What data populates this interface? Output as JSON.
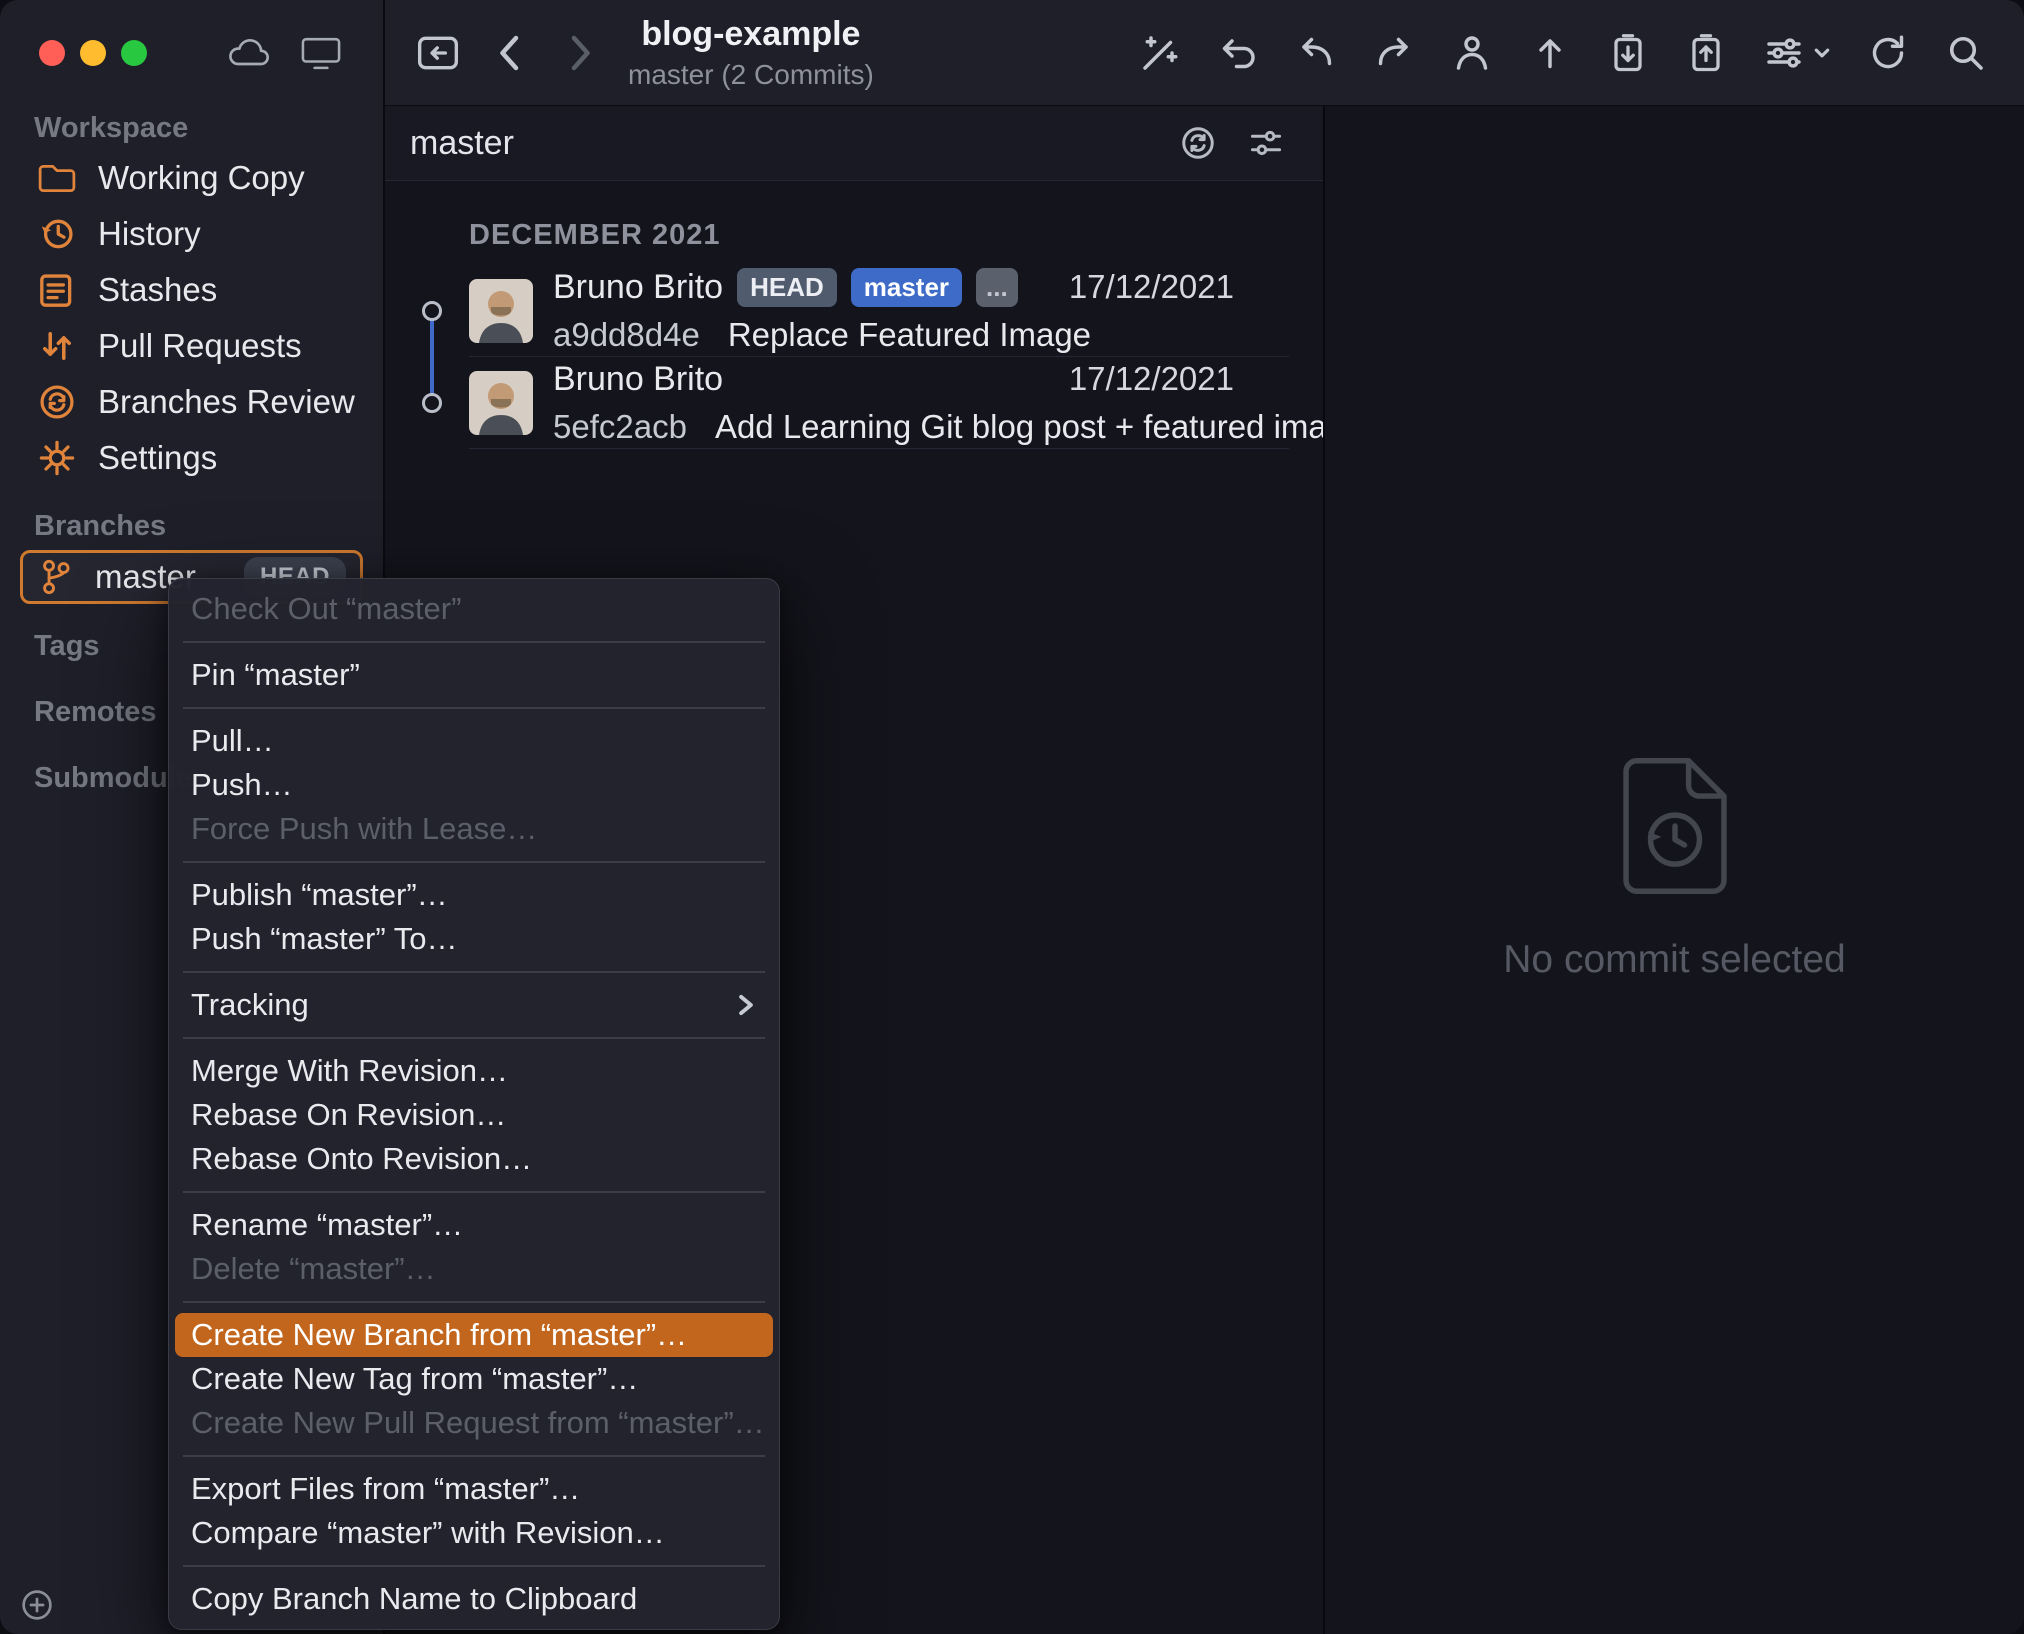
{
  "window": {
    "title": "blog-example",
    "subtitle": "master (2 Commits)"
  },
  "titlebar_icons": [
    "cloud-icon",
    "computer-icon"
  ],
  "toolbar_icons": [
    "repo-icon",
    "back-icon",
    "forward-icon",
    "wand-icon",
    "undo-icon",
    "discard-icon",
    "redo-icon",
    "commit-person-icon",
    "push-icon",
    "stash-save-icon",
    "stash-apply-icon",
    "settings-sliders-icon",
    "refresh-icon",
    "search-icon"
  ],
  "sidebar": {
    "add_button": "+",
    "sections": [
      {
        "header": "Workspace",
        "items": [
          {
            "label": "Working Copy",
            "icon": "folder-icon"
          },
          {
            "label": "History",
            "icon": "history-icon"
          },
          {
            "label": "Stashes",
            "icon": "stashes-icon"
          },
          {
            "label": "Pull Requests",
            "icon": "pull-requests-icon"
          },
          {
            "label": "Branches Review",
            "icon": "branches-review-icon"
          },
          {
            "label": "Settings",
            "icon": "gear-icon"
          }
        ]
      },
      {
        "header": "Branches",
        "items": [
          {
            "label": "master",
            "icon": "branch-icon",
            "badge": "HEAD",
            "selected": true
          }
        ]
      },
      {
        "header": "Tags",
        "items": []
      },
      {
        "header": "Remotes",
        "items": []
      },
      {
        "header": "Submodules",
        "items": []
      }
    ]
  },
  "commit_list": {
    "filter_value": "master",
    "filter_icons": [
      "compare-icon",
      "filter-options-icon"
    ],
    "group_header": "DECEMBER 2021",
    "commits": [
      {
        "author": "Bruno Brito",
        "badges": [
          {
            "label": "HEAD",
            "type": "gray"
          },
          {
            "label": "master",
            "type": "blue"
          },
          {
            "label": "...",
            "type": "more"
          }
        ],
        "hash": "a9dd8d4e",
        "message": "Replace Featured Image",
        "date": "17/12/2021"
      },
      {
        "author": "Bruno Brito",
        "badges": [],
        "hash": "5efc2acb",
        "message": "Add Learning Git blog post + featured image",
        "date": "17/12/2021"
      }
    ]
  },
  "detail_panel": {
    "empty_message": "No commit selected"
  },
  "context_menu": {
    "items": [
      {
        "label": "Check Out “master”",
        "disabled": true
      },
      {
        "separator": true
      },
      {
        "label": "Pin “master”"
      },
      {
        "separator": true
      },
      {
        "label": "Pull…"
      },
      {
        "label": "Push…"
      },
      {
        "label": "Force Push with Lease…",
        "disabled": true
      },
      {
        "separator": true
      },
      {
        "label": "Publish “master”…"
      },
      {
        "label": "Push “master” To…"
      },
      {
        "separator": true
      },
      {
        "label": "Tracking",
        "submenu": true
      },
      {
        "separator": true
      },
      {
        "label": "Merge With Revision…"
      },
      {
        "label": "Rebase On Revision…"
      },
      {
        "label": "Rebase Onto Revision…"
      },
      {
        "separator": true
      },
      {
        "label": "Rename “master”…"
      },
      {
        "label": "Delete “master”…",
        "disabled": true
      },
      {
        "separator": true
      },
      {
        "label": "Create New Branch from “master”…",
        "highlighted": true
      },
      {
        "label": "Create New Tag from “master”…"
      },
      {
        "label": "Create New Pull Request from “master”…",
        "disabled": true
      },
      {
        "separator": true
      },
      {
        "label": "Export Files from “master”…"
      },
      {
        "label": "Compare “master” with Revision…"
      },
      {
        "separator": true
      },
      {
        "label": "Copy Branch Name to Clipboard"
      }
    ]
  },
  "colors": {
    "accent_orange": "#c2661d",
    "sidebar_icon_orange": "#e0843c",
    "badge_blue": "#3e6ac8",
    "badge_gray": "#505b6e",
    "graph_blue": "#3e6bc9"
  }
}
